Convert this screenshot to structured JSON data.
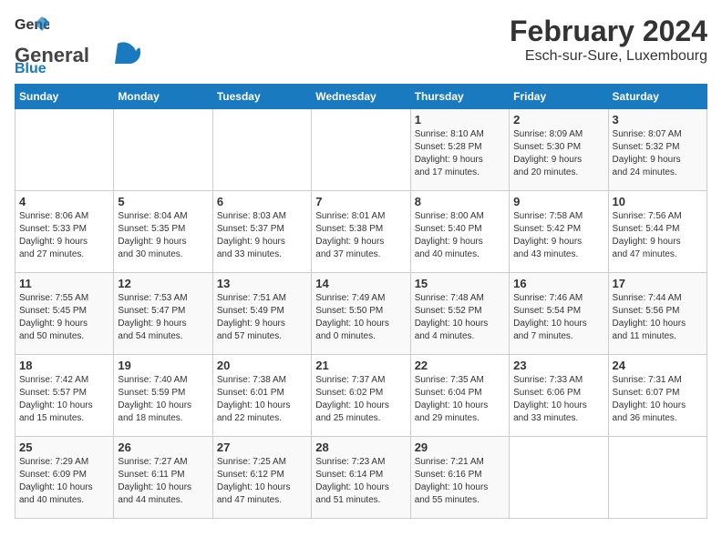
{
  "header": {
    "logo_general": "General",
    "logo_blue": "Blue",
    "title": "February 2024",
    "subtitle": "Esch-sur-Sure, Luxembourg"
  },
  "days_of_week": [
    "Sunday",
    "Monday",
    "Tuesday",
    "Wednesday",
    "Thursday",
    "Friday",
    "Saturday"
  ],
  "weeks": [
    [
      {
        "day": "",
        "info": ""
      },
      {
        "day": "",
        "info": ""
      },
      {
        "day": "",
        "info": ""
      },
      {
        "day": "",
        "info": ""
      },
      {
        "day": "1",
        "info": "Sunrise: 8:10 AM\nSunset: 5:28 PM\nDaylight: 9 hours\nand 17 minutes."
      },
      {
        "day": "2",
        "info": "Sunrise: 8:09 AM\nSunset: 5:30 PM\nDaylight: 9 hours\nand 20 minutes."
      },
      {
        "day": "3",
        "info": "Sunrise: 8:07 AM\nSunset: 5:32 PM\nDaylight: 9 hours\nand 24 minutes."
      }
    ],
    [
      {
        "day": "4",
        "info": "Sunrise: 8:06 AM\nSunset: 5:33 PM\nDaylight: 9 hours\nand 27 minutes."
      },
      {
        "day": "5",
        "info": "Sunrise: 8:04 AM\nSunset: 5:35 PM\nDaylight: 9 hours\nand 30 minutes."
      },
      {
        "day": "6",
        "info": "Sunrise: 8:03 AM\nSunset: 5:37 PM\nDaylight: 9 hours\nand 33 minutes."
      },
      {
        "day": "7",
        "info": "Sunrise: 8:01 AM\nSunset: 5:38 PM\nDaylight: 9 hours\nand 37 minutes."
      },
      {
        "day": "8",
        "info": "Sunrise: 8:00 AM\nSunset: 5:40 PM\nDaylight: 9 hours\nand 40 minutes."
      },
      {
        "day": "9",
        "info": "Sunrise: 7:58 AM\nSunset: 5:42 PM\nDaylight: 9 hours\nand 43 minutes."
      },
      {
        "day": "10",
        "info": "Sunrise: 7:56 AM\nSunset: 5:44 PM\nDaylight: 9 hours\nand 47 minutes."
      }
    ],
    [
      {
        "day": "11",
        "info": "Sunrise: 7:55 AM\nSunset: 5:45 PM\nDaylight: 9 hours\nand 50 minutes."
      },
      {
        "day": "12",
        "info": "Sunrise: 7:53 AM\nSunset: 5:47 PM\nDaylight: 9 hours\nand 54 minutes."
      },
      {
        "day": "13",
        "info": "Sunrise: 7:51 AM\nSunset: 5:49 PM\nDaylight: 9 hours\nand 57 minutes."
      },
      {
        "day": "14",
        "info": "Sunrise: 7:49 AM\nSunset: 5:50 PM\nDaylight: 10 hours\nand 0 minutes."
      },
      {
        "day": "15",
        "info": "Sunrise: 7:48 AM\nSunset: 5:52 PM\nDaylight: 10 hours\nand 4 minutes."
      },
      {
        "day": "16",
        "info": "Sunrise: 7:46 AM\nSunset: 5:54 PM\nDaylight: 10 hours\nand 7 minutes."
      },
      {
        "day": "17",
        "info": "Sunrise: 7:44 AM\nSunset: 5:56 PM\nDaylight: 10 hours\nand 11 minutes."
      }
    ],
    [
      {
        "day": "18",
        "info": "Sunrise: 7:42 AM\nSunset: 5:57 PM\nDaylight: 10 hours\nand 15 minutes."
      },
      {
        "day": "19",
        "info": "Sunrise: 7:40 AM\nSunset: 5:59 PM\nDaylight: 10 hours\nand 18 minutes."
      },
      {
        "day": "20",
        "info": "Sunrise: 7:38 AM\nSunset: 6:01 PM\nDaylight: 10 hours\nand 22 minutes."
      },
      {
        "day": "21",
        "info": "Sunrise: 7:37 AM\nSunset: 6:02 PM\nDaylight: 10 hours\nand 25 minutes."
      },
      {
        "day": "22",
        "info": "Sunrise: 7:35 AM\nSunset: 6:04 PM\nDaylight: 10 hours\nand 29 minutes."
      },
      {
        "day": "23",
        "info": "Sunrise: 7:33 AM\nSunset: 6:06 PM\nDaylight: 10 hours\nand 33 minutes."
      },
      {
        "day": "24",
        "info": "Sunrise: 7:31 AM\nSunset: 6:07 PM\nDaylight: 10 hours\nand 36 minutes."
      }
    ],
    [
      {
        "day": "25",
        "info": "Sunrise: 7:29 AM\nSunset: 6:09 PM\nDaylight: 10 hours\nand 40 minutes."
      },
      {
        "day": "26",
        "info": "Sunrise: 7:27 AM\nSunset: 6:11 PM\nDaylight: 10 hours\nand 44 minutes."
      },
      {
        "day": "27",
        "info": "Sunrise: 7:25 AM\nSunset: 6:12 PM\nDaylight: 10 hours\nand 47 minutes."
      },
      {
        "day": "28",
        "info": "Sunrise: 7:23 AM\nSunset: 6:14 PM\nDaylight: 10 hours\nand 51 minutes."
      },
      {
        "day": "29",
        "info": "Sunrise: 7:21 AM\nSunset: 6:16 PM\nDaylight: 10 hours\nand 55 minutes."
      },
      {
        "day": "",
        "info": ""
      },
      {
        "day": "",
        "info": ""
      }
    ]
  ]
}
